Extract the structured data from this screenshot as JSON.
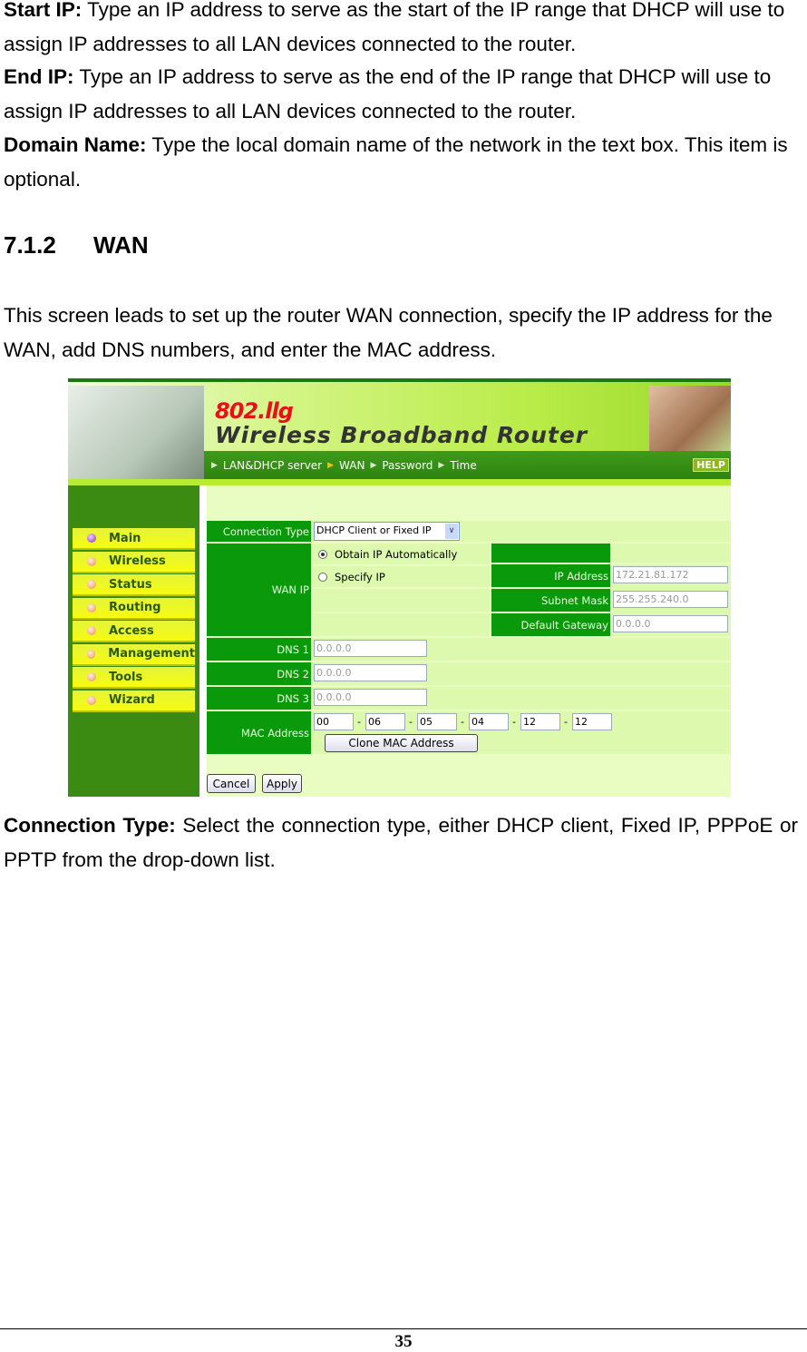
{
  "paragraphs_top": [
    {
      "term": "Start IP:",
      "text": " Type an IP address to serve as the start of the IP range that DHCP will use to assign IP addresses to all LAN devices connected to the router."
    },
    {
      "term": "End IP:",
      "text": " Type an IP address to serve as the end of the IP range that DHCP will use to assign IP addresses to all LAN devices connected to the router."
    },
    {
      "term": "Domain Name:",
      "text": " Type the local domain name of the network in the text box. This item is optional."
    }
  ],
  "heading": {
    "number": "7.1.2",
    "title": "WAN"
  },
  "intro": "This screen leads to set up the router WAN connection, specify the IP address for the WAN, add DNS numbers, and enter the MAC address.",
  "router": {
    "logo_top": "802.llg",
    "logo_bottom": "Wireless  Broadband Router",
    "nav": [
      "LAN&DHCP server",
      "WAN",
      "Password",
      "Time"
    ],
    "help": "HELP",
    "menu": [
      "Main",
      "Wireless",
      "Status",
      "Routing",
      "Access",
      "Management",
      "Tools",
      "Wizard"
    ],
    "form": {
      "connection_type_label": "Connection Type",
      "connection_type_value": "DHCP Client or Fixed IP",
      "wan_ip_label": "WAN IP",
      "obtain_auto": "Obtain IP Automatically",
      "specify_ip": "Specify IP",
      "ip_address_label": "IP Address",
      "ip_address": "172.21.81.172",
      "subnet_mask_label": "Subnet Mask",
      "subnet_mask": "255.255.240.0",
      "gateway_label": "Default Gateway",
      "gateway": "0.0.0.0",
      "dns1_label": "DNS 1",
      "dns1": "0.0.0.0",
      "dns2_label": "DNS 2",
      "dns2": "0.0.0.0",
      "dns3_label": "DNS 3",
      "dns3": "0.0.0.0",
      "mac_label": "MAC Address",
      "mac": [
        "00",
        "06",
        "05",
        "04",
        "12",
        "12"
      ],
      "mac_sep": "-",
      "clone_mac": "Clone MAC Address",
      "cancel": "Cancel",
      "apply": "Apply"
    }
  },
  "paragraph_bottom": {
    "term": "Connection Type:",
    "text": " Select the connection type, either DHCP client, Fixed IP, PPPoE or PPTP from the drop-down list."
  },
  "page_number": "35"
}
